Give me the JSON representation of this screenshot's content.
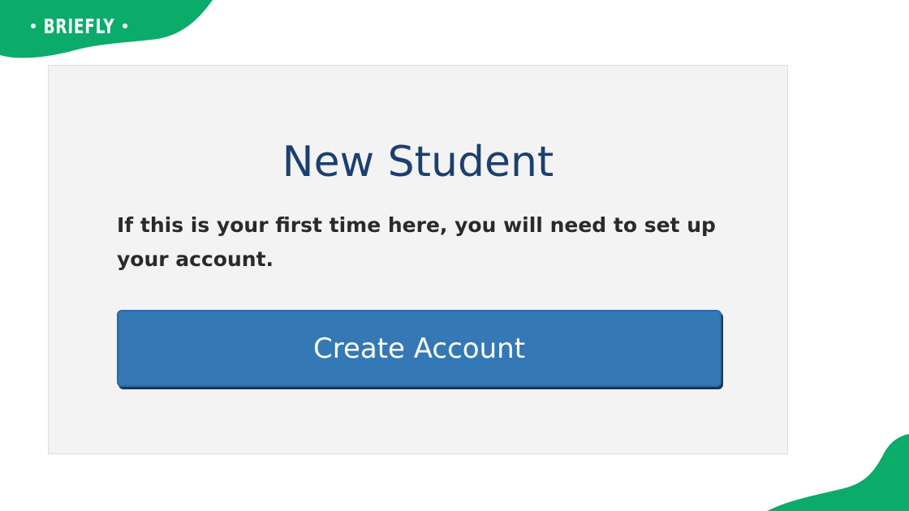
{
  "brand": {
    "name": "BRIEFLY",
    "color": "#0bab6a"
  },
  "card": {
    "title": "New Student",
    "description": "If this is your first time here, you will need to set up your account.",
    "button_label": "Create Account"
  },
  "colors": {
    "title": "#1b3f70",
    "button": "#3478b6",
    "card_background": "#f3f3f3"
  }
}
